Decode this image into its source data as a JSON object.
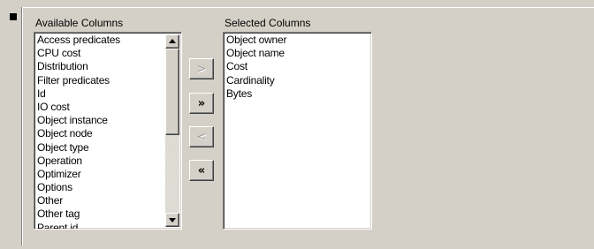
{
  "available_columns": {
    "label": "Available Columns",
    "items": [
      "Access predicates",
      "CPU cost",
      "Distribution",
      "Filter predicates",
      "Id",
      "IO cost",
      "Object instance",
      "Object node",
      "Object type",
      "Operation",
      "Optimizer",
      "Options",
      "Other",
      "Other tag",
      "Parent id"
    ]
  },
  "selected_columns": {
    "label": "Selected Columns",
    "items": [
      "Object owner",
      "Object name",
      "Cost",
      "Cardinality",
      "Bytes"
    ]
  },
  "buttons": {
    "add_one": ">",
    "add_all": "»",
    "remove_one": "<",
    "remove_all": "«"
  },
  "colors": {
    "window_bg": "#d4d0c8",
    "list_bg": "#ffffff",
    "disabled_text": "#a0a0a0"
  }
}
